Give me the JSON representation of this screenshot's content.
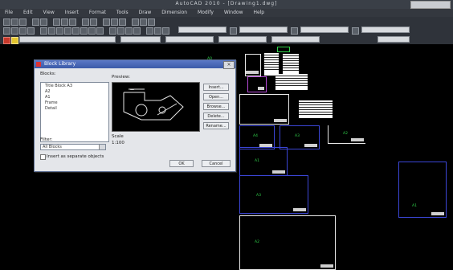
{
  "window": {
    "title": "AutoCAD 2010 - [Drawing1.dwg]"
  },
  "menubar": {
    "items": [
      "File",
      "Edit",
      "View",
      "Insert",
      "Format",
      "Tools",
      "Draw",
      "Dimension",
      "Modify",
      "Window",
      "Help"
    ]
  },
  "dialog": {
    "title": "Block Library",
    "close_label": "×",
    "list_label": "Blocks:",
    "list_items": [
      "Title Block A3",
      "A2",
      "A1",
      "Frame",
      "Detail"
    ],
    "preview_label": "Preview:",
    "desc_label": "Scale",
    "desc_value": "1:100",
    "filter_label": "Filter:",
    "filter_value": "All Blocks",
    "checkbox_label": "Insert as separate objects",
    "buttons": [
      "Insert...",
      "Open...",
      "Browse...",
      "Delete...",
      "Rename..."
    ],
    "ok_label": "OK",
    "cancel_label": "Cancel"
  },
  "canvas": {
    "small_labels": [
      "A4",
      "A3",
      "A2",
      "A1",
      "A3",
      "A2",
      "A1",
      "A0",
      "A4"
    ]
  },
  "colors": {
    "accent": "#3b5aa8",
    "drawing_bg": "#000000",
    "sheet_green": "#2fd04a"
  }
}
